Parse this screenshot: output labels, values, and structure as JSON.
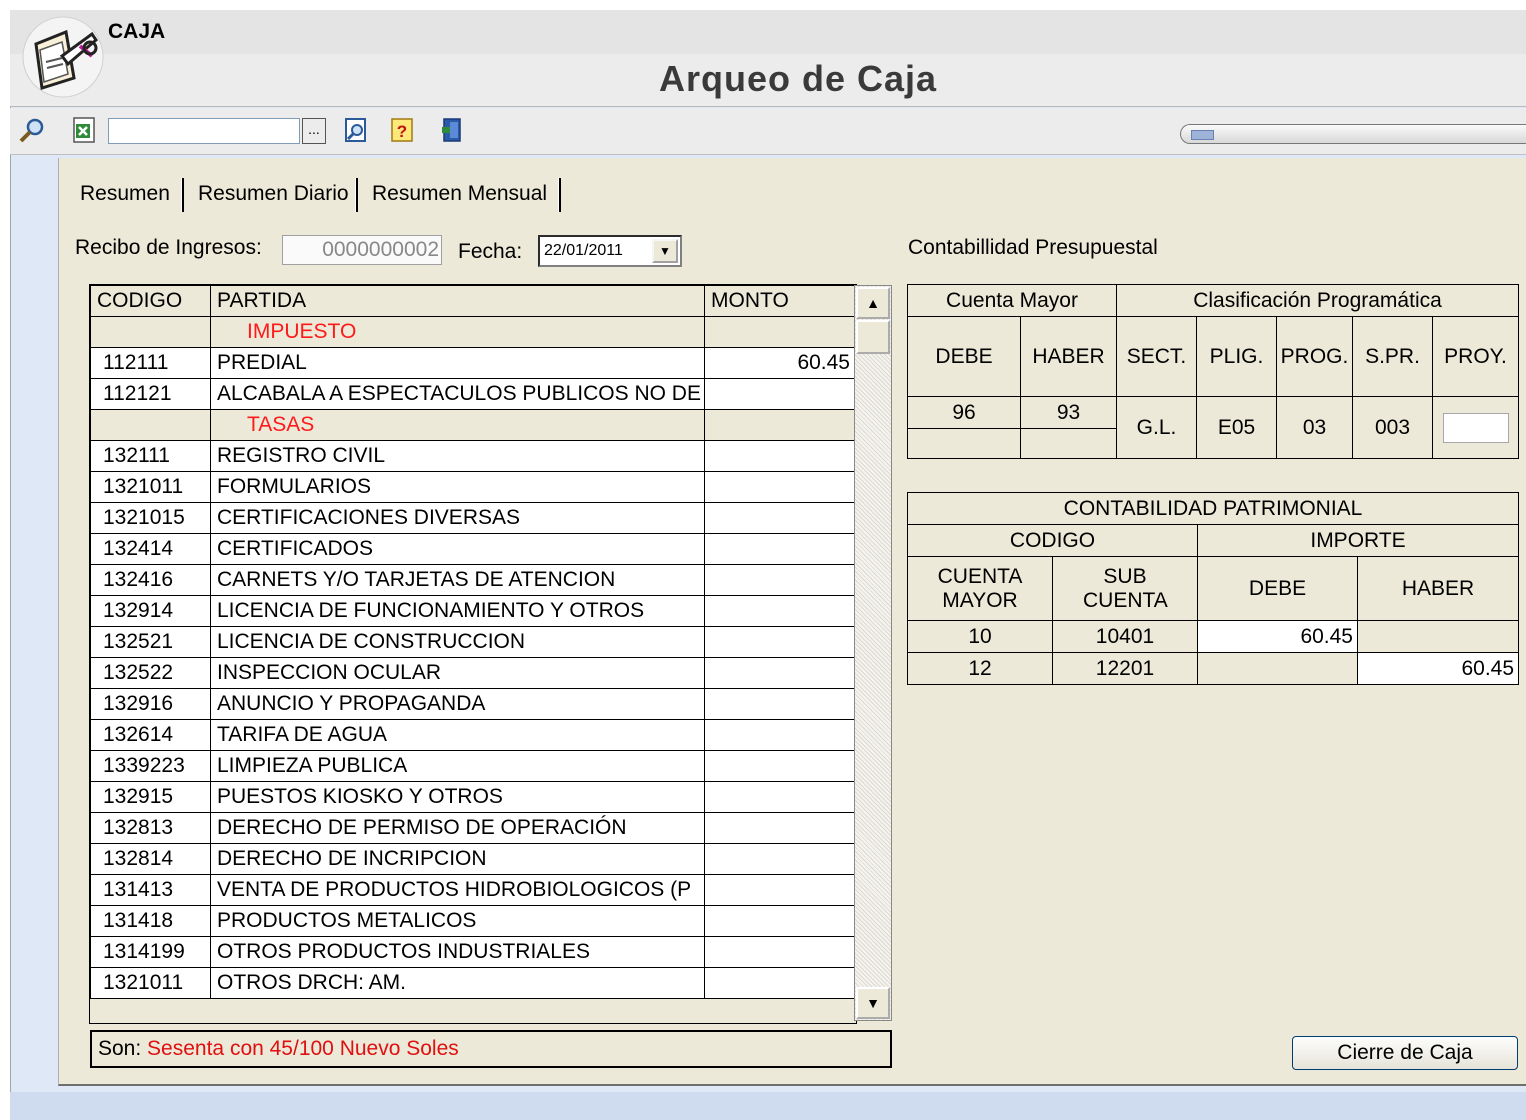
{
  "window": {
    "app_name": "CAJA",
    "page_title": "Arqueo de Caja"
  },
  "toolbar": {
    "search_value": "",
    "browse_label": "...",
    "progress_fraction": 0.06
  },
  "tabs": [
    {
      "label": "Resumen"
    },
    {
      "label": "Resumen Diario"
    },
    {
      "label": "Resumen Mensual"
    }
  ],
  "form": {
    "recibo_label": "Recibo de Ingresos:",
    "recibo_value": "0000000002",
    "fecha_label": "Fecha:",
    "fecha_value": "22/01/2011"
  },
  "grid": {
    "headers": {
      "codigo": "CODIGO",
      "partida": "PARTIDA",
      "monto": "MONTO"
    },
    "rows": [
      {
        "codigo": "",
        "partida": "IMPUESTO",
        "monto": ""
      },
      {
        "codigo": "112111",
        "partida": "PREDIAL",
        "monto": "60.45"
      },
      {
        "codigo": "112121",
        "partida": "ALCABALA A ESPECTACULOS PUBLICOS NO DE",
        "monto": ""
      },
      {
        "codigo": "",
        "partida": "TASAS",
        "monto": ""
      },
      {
        "codigo": "132111",
        "partida": "REGISTRO CIVIL",
        "monto": ""
      },
      {
        "codigo": "1321011",
        "partida": "FORMULARIOS",
        "monto": ""
      },
      {
        "codigo": "1321015",
        "partida": "CERTIFICACIONES DIVERSAS",
        "monto": ""
      },
      {
        "codigo": "132414",
        "partida": "CERTIFICADOS",
        "monto": ""
      },
      {
        "codigo": "132416",
        "partida": "CARNETS Y/O TARJETAS DE ATENCION",
        "monto": ""
      },
      {
        "codigo": "132914",
        "partida": "LICENCIA DE FUNCIONAMIENTO Y OTROS",
        "monto": ""
      },
      {
        "codigo": "132521",
        "partida": "LICENCIA DE CONSTRUCCION",
        "monto": ""
      },
      {
        "codigo": "132522",
        "partida": "INSPECCION OCULAR",
        "monto": ""
      },
      {
        "codigo": "132916",
        "partida": "ANUNCIO Y PROPAGANDA",
        "monto": ""
      },
      {
        "codigo": "132614",
        "partida": "TARIFA DE AGUA",
        "monto": ""
      },
      {
        "codigo": "1339223",
        "partida": "LIMPIEZA PUBLICA",
        "monto": ""
      },
      {
        "codigo": "132915",
        "partida": "PUESTOS KIOSKO Y OTROS",
        "monto": ""
      },
      {
        "codigo": "132813",
        "partida": "DERECHO DE PERMISO DE OPERACIÓN",
        "monto": ""
      },
      {
        "codigo": "132814",
        "partida": "DERECHO DE INCRIPCION",
        "monto": ""
      },
      {
        "codigo": "131413",
        "partida": "VENTA DE PRODUCTOS HIDROBIOLOGICOS (P",
        "monto": ""
      },
      {
        "codigo": "131418",
        "partida": "PRODUCTOS METALICOS",
        "monto": ""
      },
      {
        "codigo": "1314199",
        "partida": "OTROS PRODUCTOS INDUSTRIALES",
        "monto": ""
      },
      {
        "codigo": "1321011",
        "partida": "OTROS DRCH: AM.",
        "monto": ""
      }
    ]
  },
  "son": {
    "label": "Son:",
    "value": "Sesenta con 45/100 Nuevo Soles"
  },
  "presupuestal": {
    "title": "Contabillidad Presupuestal",
    "cuenta_mayor": "Cuenta Mayor",
    "clasificacion": "Clasificación Programática",
    "cols": [
      "DEBE",
      "HABER",
      "SECT.",
      "PLIG.",
      "PROG.",
      "S.PR.",
      "PROY."
    ],
    "debe": "96",
    "haber": "93",
    "sect": "G.L.",
    "plig": "E05",
    "prog": "03",
    "spr": "003",
    "proy": ""
  },
  "patrimonial": {
    "title": "CONTABILIDAD PATRIMONIAL",
    "codigo": "CODIGO",
    "importe": "IMPORTE",
    "cuenta_mayor": "CUENTA MAYOR",
    "sub_cuenta": "SUB CUENTA",
    "debe": "DEBE",
    "haber": "HABER",
    "rows": [
      {
        "cuenta": "10",
        "sub": "10401",
        "debe": "60.45",
        "haber": ""
      },
      {
        "cuenta": "12",
        "sub": "12201",
        "debe": "",
        "haber": "60.45"
      }
    ]
  },
  "actions": {
    "cierre_label": "Cierre de Caja"
  }
}
